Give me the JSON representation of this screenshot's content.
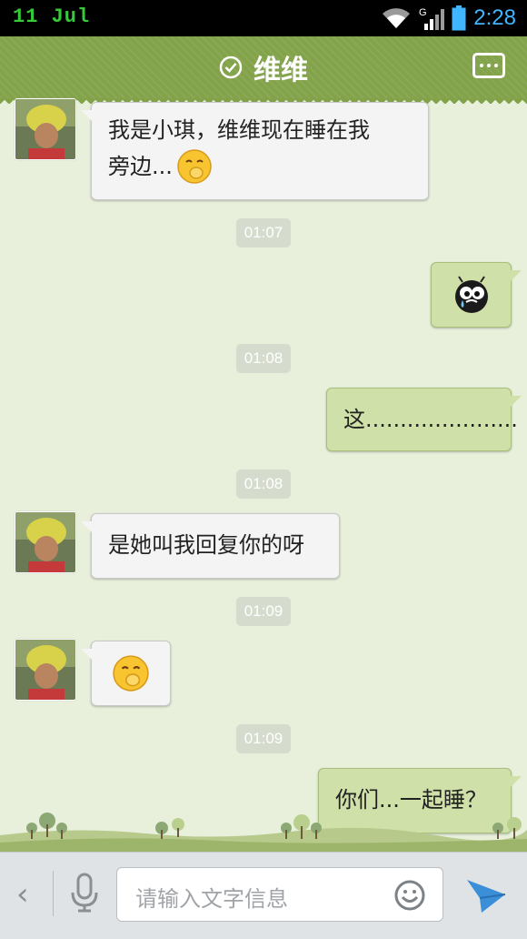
{
  "status_bar": {
    "date": "11 Jul",
    "network": "G",
    "time": "2:28"
  },
  "header": {
    "title": "维维",
    "more_icon": "more-dots-icon",
    "verified_icon": "check-circle-icon"
  },
  "messages": [
    {
      "side": "left",
      "line1": "我是小琪，维维现在睡在我",
      "line2": "旁边...",
      "emoji": "shy-emoji"
    },
    {
      "timestamp": "01:07"
    },
    {
      "side": "right",
      "emoji": "crying-ball-emoji"
    },
    {
      "timestamp": "01:08"
    },
    {
      "side": "right",
      "text": "这......................"
    },
    {
      "timestamp": "01:08"
    },
    {
      "side": "left",
      "text": "是她叫我回复你的呀"
    },
    {
      "timestamp": "01:09"
    },
    {
      "side": "left",
      "emoji": "shy-emoji"
    },
    {
      "timestamp": "01:09"
    },
    {
      "side": "right",
      "text": "你们...一起睡？"
    }
  ],
  "input_bar": {
    "placeholder": "请输入文字信息",
    "back_label": "‹"
  },
  "colors": {
    "header": "#83a34a",
    "background": "#e8f0dc",
    "right_bubble": "#cfe0a8",
    "left_bubble": "#f4f4f4",
    "time_accent": "#3fb6ff"
  }
}
